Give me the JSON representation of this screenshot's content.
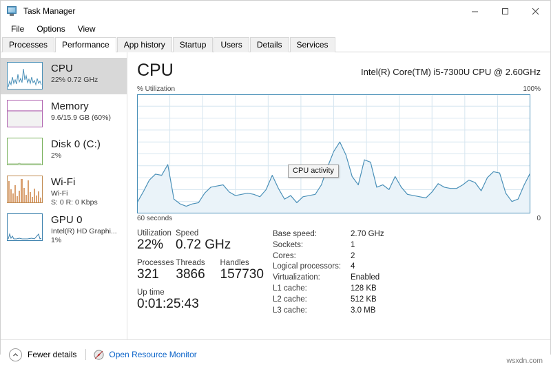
{
  "window": {
    "title": "Task Manager",
    "icon": "task-manager-icon",
    "controls": {
      "minimize": "–",
      "maximize": "□",
      "close": "✕"
    }
  },
  "menu": {
    "items": [
      "File",
      "Options",
      "View"
    ]
  },
  "tabs": [
    {
      "label": "Processes",
      "active": false
    },
    {
      "label": "Performance",
      "active": true
    },
    {
      "label": "App history",
      "active": false
    },
    {
      "label": "Startup",
      "active": false
    },
    {
      "label": "Users",
      "active": false
    },
    {
      "label": "Details",
      "active": false
    },
    {
      "label": "Services",
      "active": false
    }
  ],
  "sidebar": {
    "items": [
      {
        "name": "CPU",
        "line2": "22% 0.72 GHz",
        "line3": "",
        "selected": true,
        "color": "#4a90b8"
      },
      {
        "name": "Memory",
        "line2": "9.6/15.9 GB (60%)",
        "line3": "",
        "selected": false,
        "color": "#b064b0"
      },
      {
        "name": "Disk 0 (C:)",
        "line2": "2%",
        "line3": "",
        "selected": false,
        "color": "#77b05a"
      },
      {
        "name": "Wi-Fi",
        "line2": "Wi-Fi",
        "line3": "S: 0 R: 0 Kbps",
        "selected": false,
        "color": "#c06a2a"
      },
      {
        "name": "GPU 0",
        "line2": "Intel(R) HD Graphi...",
        "line3": "1%",
        "selected": false,
        "color": "#3b80ad"
      }
    ]
  },
  "main": {
    "title": "CPU",
    "subtitle": "Intel(R) Core(TM) i5-7300U CPU @ 2.60GHz",
    "axis_top_left": "% Utilization",
    "axis_top_right": "100%",
    "axis_bottom_left": "60 seconds",
    "axis_bottom_right": "0",
    "tooltip": "CPU activity",
    "line_color": "#4a90b8",
    "fill_color": "#eaf3f9",
    "grid_color": "#d6e6f0"
  },
  "stats": {
    "left": [
      {
        "labels": [
          "Utilization",
          "Speed"
        ],
        "values": [
          "22%",
          "0.72 GHz"
        ]
      },
      {
        "labels": [
          "Processes",
          "Threads",
          "Handles"
        ],
        "values": [
          "321",
          "3866",
          "157730"
        ]
      },
      {
        "labels": [
          "Up time"
        ],
        "values": [
          "0:01:25:43"
        ]
      }
    ],
    "right": [
      {
        "key": "Base speed:",
        "value": "2.70 GHz"
      },
      {
        "key": "Sockets:",
        "value": "1"
      },
      {
        "key": "Cores:",
        "value": "2"
      },
      {
        "key": "Logical processors:",
        "value": "4"
      },
      {
        "key": "Virtualization:",
        "value": "Enabled"
      },
      {
        "key": "L1 cache:",
        "value": "128 KB"
      },
      {
        "key": "L2 cache:",
        "value": "512 KB"
      },
      {
        "key": "L3 cache:",
        "value": "3.0 MB"
      }
    ]
  },
  "statusbar": {
    "fewer_details": "Fewer details",
    "resource_monitor": "Open Resource Monitor",
    "watermark": "wsxdn.com"
  },
  "chart_data": {
    "type": "area",
    "title": "CPU",
    "xlabel": "60 seconds",
    "ylabel": "% Utilization",
    "ylim": [
      0,
      100
    ],
    "grid": true,
    "x": [
      0,
      1,
      2,
      3,
      4,
      5,
      6,
      7,
      8,
      9,
      10,
      11,
      12,
      13,
      14,
      15,
      16,
      17,
      18,
      19,
      20,
      21,
      22,
      23,
      24,
      25,
      26,
      27,
      28,
      29,
      30,
      31,
      32,
      33,
      34,
      35,
      36,
      37,
      38,
      39,
      40,
      41,
      42,
      43,
      44,
      45,
      46,
      47,
      48,
      49,
      50,
      51,
      52,
      53,
      54,
      55,
      56,
      57,
      58,
      59,
      60
    ],
    "values": [
      9,
      18,
      28,
      33,
      32,
      41,
      12,
      8,
      6,
      8,
      9,
      17,
      22,
      23,
      24,
      18,
      15,
      16,
      17,
      16,
      14,
      20,
      32,
      21,
      12,
      15,
      9,
      14,
      15,
      16,
      24,
      39,
      52,
      60,
      49,
      31,
      24,
      45,
      43,
      22,
      24,
      20,
      31,
      22,
      16,
      15,
      14,
      13,
      18,
      25,
      22,
      21,
      21,
      24,
      28,
      26,
      19,
      30,
      35,
      34,
      17,
      10,
      12,
      24,
      34
    ]
  }
}
